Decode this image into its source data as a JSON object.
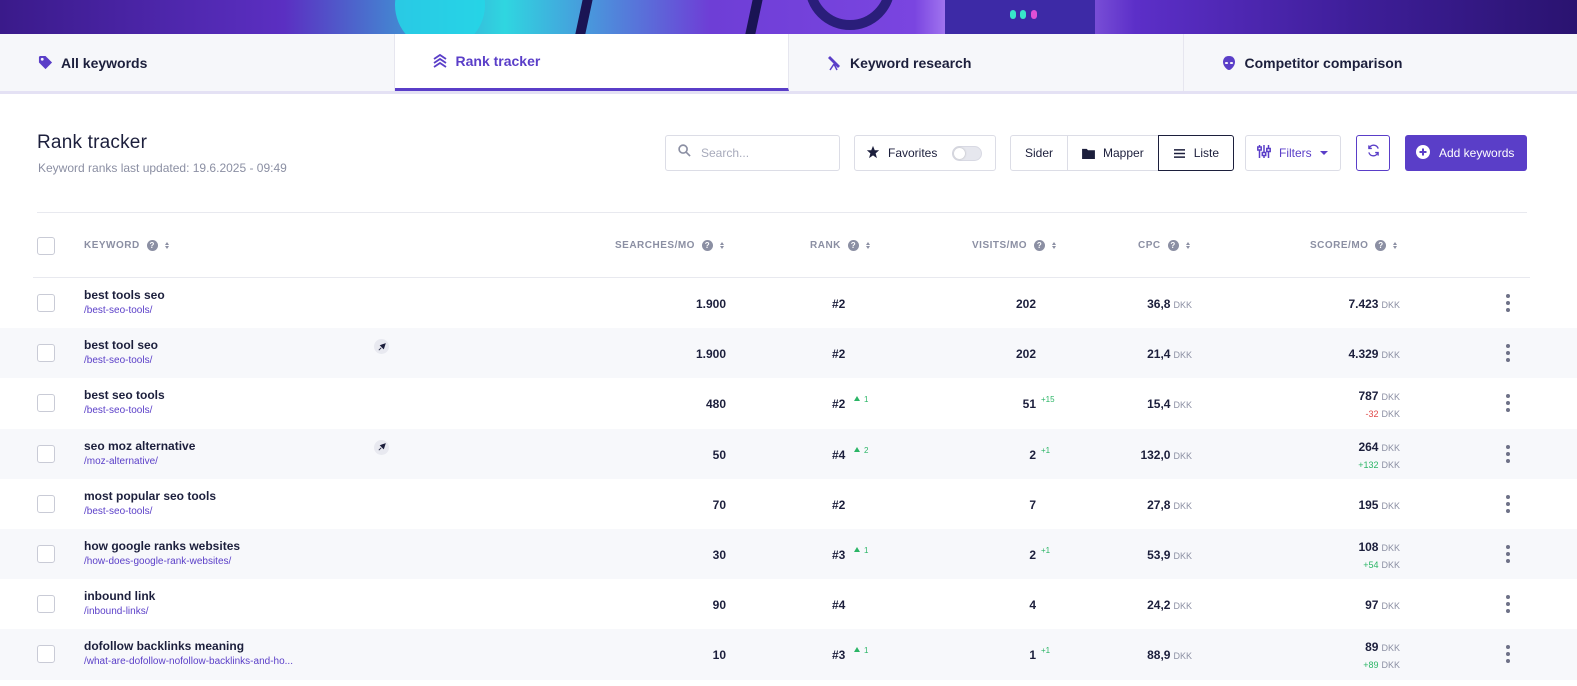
{
  "tabs": [
    {
      "label": "All keywords",
      "icon": "tag-icon",
      "active": false
    },
    {
      "label": "Rank tracker",
      "icon": "layers-icon",
      "active": true
    },
    {
      "label": "Keyword research",
      "icon": "telescope-icon",
      "active": false
    },
    {
      "label": "Competitor comparison",
      "icon": "alien-icon",
      "active": false
    }
  ],
  "header": {
    "title": "Rank tracker",
    "subtitle": "Keyword ranks last updated: 19.6.2025 - 09:49"
  },
  "search": {
    "placeholder": "Search...",
    "value": ""
  },
  "favorites": {
    "label": "Favorites",
    "enabled": false
  },
  "view": {
    "options": [
      "Sider",
      "Mapper",
      "Liste"
    ],
    "selected": "Liste"
  },
  "filters": {
    "label": "Filters"
  },
  "add_button": {
    "label": "Add keywords"
  },
  "colors": {
    "accent": "#5a3ec8",
    "text": "#1c1f3c",
    "muted": "#8b8fa3",
    "positive": "#2bb566",
    "negative": "#e04848"
  },
  "columns": {
    "keyword": "KEYWORD",
    "searches": "SEARCHES/MO",
    "rank": "RANK",
    "visits": "VISITS/MO",
    "cpc": "CPC",
    "score": "SCORE/MO"
  },
  "currency": "DKK",
  "rows": [
    {
      "keyword": "best tools seo",
      "url": "/best-seo-tools/",
      "pinned": false,
      "searches": "1.900",
      "rank": "#2",
      "rank_change": "",
      "visits": "202",
      "visits_change": "",
      "cpc": "36,8",
      "score": "7.423",
      "score_change": "",
      "score_change_sign": ""
    },
    {
      "keyword": "best tool seo",
      "url": "/best-seo-tools/",
      "pinned": true,
      "searches": "1.900",
      "rank": "#2",
      "rank_change": "",
      "visits": "202",
      "visits_change": "",
      "cpc": "21,4",
      "score": "4.329",
      "score_change": "",
      "score_change_sign": ""
    },
    {
      "keyword": "best seo tools",
      "url": "/best-seo-tools/",
      "pinned": false,
      "searches": "480",
      "rank": "#2",
      "rank_change": "1",
      "visits": "51",
      "visits_change": "+15",
      "cpc": "15,4",
      "score": "787",
      "score_change": "-32",
      "score_change_sign": "neg"
    },
    {
      "keyword": "seo moz alternative",
      "url": "/moz-alternative/",
      "pinned": true,
      "searches": "50",
      "rank": "#4",
      "rank_change": "2",
      "visits": "2",
      "visits_change": "+1",
      "cpc": "132,0",
      "score": "264",
      "score_change": "+132",
      "score_change_sign": "pos"
    },
    {
      "keyword": "most popular seo tools",
      "url": "/best-seo-tools/",
      "pinned": false,
      "searches": "70",
      "rank": "#2",
      "rank_change": "",
      "visits": "7",
      "visits_change": "",
      "cpc": "27,8",
      "score": "195",
      "score_change": "",
      "score_change_sign": ""
    },
    {
      "keyword": "how google ranks websites",
      "url": "/how-does-google-rank-websites/",
      "pinned": false,
      "searches": "30",
      "rank": "#3",
      "rank_change": "1",
      "visits": "2",
      "visits_change": "+1",
      "cpc": "53,9",
      "score": "108",
      "score_change": "+54",
      "score_change_sign": "pos"
    },
    {
      "keyword": "inbound link",
      "url": "/inbound-links/",
      "pinned": false,
      "searches": "90",
      "rank": "#4",
      "rank_change": "",
      "visits": "4",
      "visits_change": "",
      "cpc": "24,2",
      "score": "97",
      "score_change": "",
      "score_change_sign": ""
    },
    {
      "keyword": "dofollow backlinks meaning",
      "url": "/what-are-dofollow-nofollow-backlinks-and-ho...",
      "pinned": false,
      "searches": "10",
      "rank": "#3",
      "rank_change": "1",
      "visits": "1",
      "visits_change": "+1",
      "cpc": "88,9",
      "score": "89",
      "score_change": "+89",
      "score_change_sign": "pos"
    }
  ]
}
